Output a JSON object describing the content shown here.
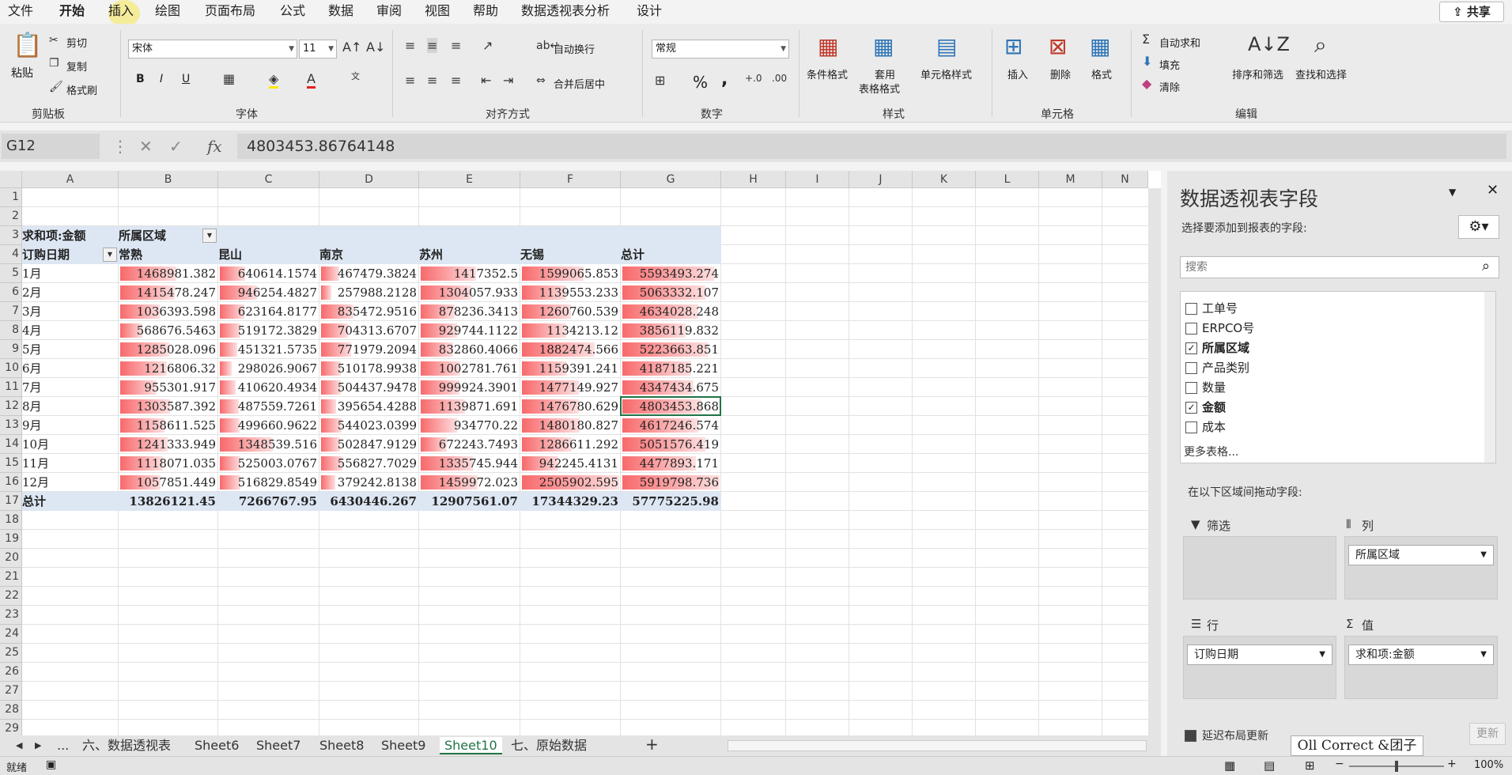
{
  "menu": {
    "items": [
      "文件",
      "开始",
      "插入",
      "绘图",
      "页面布局",
      "公式",
      "数据",
      "审阅",
      "视图",
      "帮助",
      "数据透视表分析",
      "设计"
    ],
    "share": "共享"
  },
  "ribbon": {
    "clipboard": {
      "paste": "粘贴",
      "cut": "剪切",
      "copy": "复制",
      "format_painter": "格式刷",
      "label": "剪贴板"
    },
    "font": {
      "name": "宋体",
      "size": "11",
      "label": "字体",
      "bold": "B",
      "italic": "I",
      "underline": "U"
    },
    "align": {
      "wrap": "自动换行",
      "merge": "合并后居中",
      "label": "对齐方式"
    },
    "number": {
      "format": "常规",
      "label": "数字",
      "percent": "%",
      "comma": ","
    },
    "styles": {
      "cond": "条件格式",
      "table1": "套用",
      "table2": "表格格式",
      "cell": "单元格样式",
      "label": "样式"
    },
    "cells": {
      "insert": "插入",
      "delete": "删除",
      "format": "格式",
      "label": "单元格"
    },
    "editing": {
      "autosum": "自动求和",
      "fill": "填充",
      "clear": "清除",
      "sort": "排序和筛选",
      "find": "查找和选择",
      "label": "编辑"
    }
  },
  "formula": {
    "name_box": "G12",
    "fx": "fx",
    "value": "4803453.86764148"
  },
  "columns": [
    "A",
    "B",
    "C",
    "D",
    "E",
    "F",
    "G",
    "H",
    "I",
    "J",
    "K",
    "L",
    "M",
    "N"
  ],
  "rows": [
    "1",
    "2",
    "3",
    "4",
    "5",
    "6",
    "7",
    "8",
    "9",
    "10",
    "11",
    "12",
    "13",
    "14",
    "15",
    "16",
    "17",
    "18",
    "19",
    "20",
    "21",
    "22",
    "23",
    "24",
    "25",
    "26",
    "27",
    "28",
    "29"
  ],
  "pivot": {
    "corner": "求和项:金额",
    "col_field": "所属区域",
    "row_field": "订购日期",
    "headers": [
      "常熟",
      "昆山",
      "南京",
      "苏州",
      "无锡",
      "总计"
    ],
    "body": [
      {
        "label": "1月",
        "v": [
          "1468981.382",
          "640614.1574",
          "467479.3824",
          "1417352.5",
          "1599065.853",
          "5593493.274"
        ],
        "b": [
          0.585,
          0.256,
          0.186,
          0.565,
          0.638,
          0.945
        ]
      },
      {
        "label": "2月",
        "v": [
          "1415478.247",
          "946254.4827",
          "257988.2128",
          "1304057.933",
          "1139553.233",
          "5063332.107"
        ],
        "b": [
          0.564,
          0.377,
          0.103,
          0.52,
          0.454,
          0.855
        ]
      },
      {
        "label": "3月",
        "v": [
          "1036393.598",
          "623164.8177",
          "835472.9516",
          "878236.3413",
          "1260760.539",
          "4634028.248"
        ],
        "b": [
          0.413,
          0.249,
          0.333,
          0.35,
          0.503,
          0.783
        ]
      },
      {
        "label": "4月",
        "v": [
          "568676.5463",
          "519172.3829",
          "704313.6707",
          "929744.1122",
          "1134213.12",
          "3856119.832"
        ],
        "b": [
          0.227,
          0.207,
          0.281,
          0.371,
          0.452,
          0.651
        ]
      },
      {
        "label": "5月",
        "v": [
          "1285028.096",
          "451321.5735",
          "771979.2094",
          "832860.4066",
          "1882474.566",
          "5223663.851"
        ],
        "b": [
          0.512,
          0.18,
          0.308,
          0.332,
          0.751,
          0.882
        ]
      },
      {
        "label": "6月",
        "v": [
          "1216806.32",
          "298026.9067",
          "510178.9938",
          "1002781.761",
          "1159391.241",
          "4187185.221"
        ],
        "b": [
          0.485,
          0.119,
          0.203,
          0.4,
          0.462,
          0.707
        ]
      },
      {
        "label": "7月",
        "v": [
          "955301.917",
          "410620.4934",
          "504437.9478",
          "999924.3901",
          "1477149.927",
          "4347434.675"
        ],
        "b": [
          0.381,
          0.164,
          0.201,
          0.399,
          0.589,
          0.734
        ]
      },
      {
        "label": "8月",
        "v": [
          "1303587.392",
          "487559.7261",
          "395654.4288",
          "1139871.691",
          "1476780.629",
          "4803453.868"
        ],
        "b": [
          0.52,
          0.194,
          0.158,
          0.454,
          0.589,
          0.811
        ]
      },
      {
        "label": "9月",
        "v": [
          "1158611.525",
          "499660.9622",
          "544023.0399",
          "934770.22",
          "1480180.827",
          "4617246.574"
        ],
        "b": [
          0.462,
          0.199,
          0.217,
          0.373,
          0.59,
          0.78
        ]
      },
      {
        "label": "10月",
        "v": [
          "1241333.949",
          "1348539.516",
          "502847.9129",
          "672243.7493",
          "1286611.292",
          "5051576.419"
        ],
        "b": [
          0.495,
          0.538,
          0.2,
          0.268,
          0.513,
          0.853
        ]
      },
      {
        "label": "11月",
        "v": [
          "1118071.035",
          "525003.0767",
          "556827.7029",
          "1335745.944",
          "942245.4131",
          "4477893.171"
        ],
        "b": [
          0.446,
          0.209,
          0.222,
          0.533,
          0.376,
          0.756
        ]
      },
      {
        "label": "12月",
        "v": [
          "1057851.449",
          "516829.8549",
          "379242.8138",
          "1459972.023",
          "2505902.595",
          "5919798.736"
        ],
        "b": [
          0.422,
          0.206,
          0.151,
          0.582,
          1.0,
          1.0
        ]
      }
    ],
    "total_label": "总计",
    "totals": [
      "13826121.45",
      "7266767.95",
      "6430446.267",
      "12907561.07",
      "17344329.23",
      "57775225.98"
    ]
  },
  "sheets": {
    "tabs": [
      "六、数据透视表",
      "Sheet6",
      "Sheet7",
      "Sheet8",
      "Sheet9",
      "Sheet10",
      "七、原始数据"
    ],
    "active": "Sheet10",
    "add": "+",
    "ellipsis": "..."
  },
  "status": {
    "ready": "就绪",
    "zoom": "100%"
  },
  "pane": {
    "title": "数据透视表字段",
    "subtitle": "选择要添加到报表的字段:",
    "search": "搜索",
    "fields": [
      {
        "name": "工单号",
        "checked": false
      },
      {
        "name": "ERPCO号",
        "checked": false
      },
      {
        "name": "所属区域",
        "checked": true
      },
      {
        "name": "产品类别",
        "checked": false
      },
      {
        "name": "数量",
        "checked": false
      },
      {
        "name": "金额",
        "checked": true
      },
      {
        "name": "成本",
        "checked": false
      }
    ],
    "more": "更多表格...",
    "drag_hint": "在以下区域间拖动字段:",
    "filter": "筛选",
    "columns": "列",
    "rows": "行",
    "values": "值",
    "col_value": "所属区域",
    "row_value": "订购日期",
    "val_value": "求和项:金额",
    "defer": "延迟布局更新",
    "update": "更新"
  },
  "watermark": "Oll Correct &团子",
  "colors": {
    "bar": "#f8696b",
    "pivot_header": "#dde7f3",
    "accent": "#217346"
  }
}
